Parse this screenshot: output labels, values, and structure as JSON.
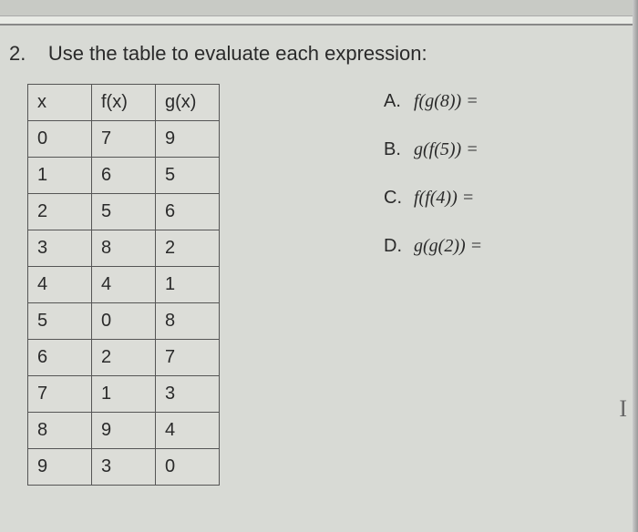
{
  "question_number": "2.",
  "question_text": "Use the table to evaluate each expression:",
  "table": {
    "headers": [
      "x",
      "f(x)",
      "g(x)"
    ],
    "rows": [
      [
        "0",
        "7",
        "9"
      ],
      [
        "1",
        "6",
        "5"
      ],
      [
        "2",
        "5",
        "6"
      ],
      [
        "3",
        "8",
        "2"
      ],
      [
        "4",
        "4",
        "1"
      ],
      [
        "5",
        "0",
        "8"
      ],
      [
        "6",
        "2",
        "7"
      ],
      [
        "7",
        "1",
        "3"
      ],
      [
        "8",
        "9",
        "4"
      ],
      [
        "9",
        "3",
        "0"
      ]
    ]
  },
  "subquestions": [
    {
      "label": "A.",
      "expr": "f(g(8)) ="
    },
    {
      "label": "B.",
      "expr": "g(f(5)) ="
    },
    {
      "label": "C.",
      "expr": "f(f(4)) ="
    },
    {
      "label": "D.",
      "expr": "g(g(2)) ="
    }
  ],
  "chart_data": {
    "type": "table",
    "columns": [
      "x",
      "f(x)",
      "g(x)"
    ],
    "data": [
      {
        "x": 0,
        "f(x)": 7,
        "g(x)": 9
      },
      {
        "x": 1,
        "f(x)": 6,
        "g(x)": 5
      },
      {
        "x": 2,
        "f(x)": 5,
        "g(x)": 6
      },
      {
        "x": 3,
        "f(x)": 8,
        "g(x)": 2
      },
      {
        "x": 4,
        "f(x)": 4,
        "g(x)": 1
      },
      {
        "x": 5,
        "f(x)": 0,
        "g(x)": 8
      },
      {
        "x": 6,
        "f(x)": 2,
        "g(x)": 7
      },
      {
        "x": 7,
        "f(x)": 1,
        "g(x)": 3
      },
      {
        "x": 8,
        "f(x)": 9,
        "g(x)": 4
      },
      {
        "x": 9,
        "f(x)": 3,
        "g(x)": 0
      }
    ]
  },
  "cursor_text": "I"
}
